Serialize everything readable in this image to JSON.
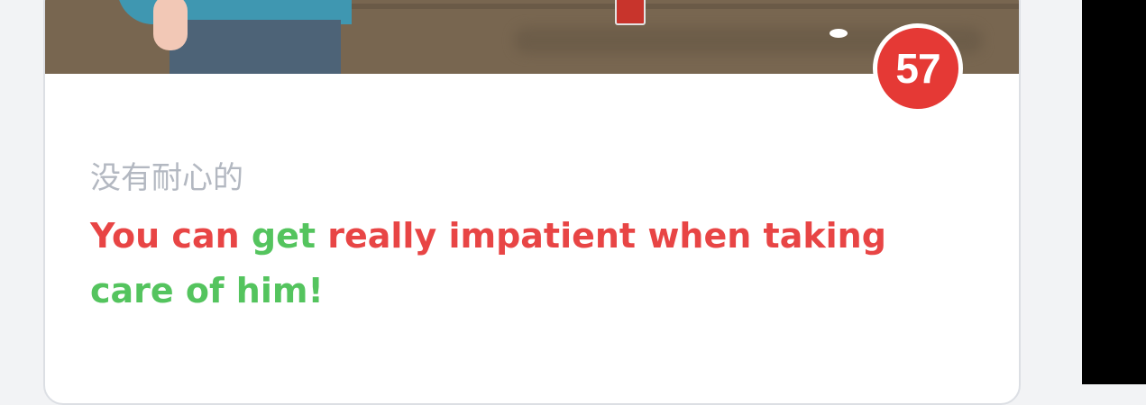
{
  "card": {
    "score": "57",
    "word_zh": "没有耐心的",
    "sentence_parts": [
      {
        "text": "You can ",
        "color": "#e84545"
      },
      {
        "text": "get",
        "color": "#54c45e"
      },
      {
        "text": " really impatient when taking ",
        "color": "#e84545"
      },
      {
        "text": "care of him!",
        "color": "#54c45e"
      }
    ],
    "illustration_icon": "person-illustration"
  },
  "colors": {
    "accent_red": "#e53935",
    "text_red": "#e84545",
    "text_green": "#54c45e",
    "text_gray": "#b3b8c1"
  }
}
